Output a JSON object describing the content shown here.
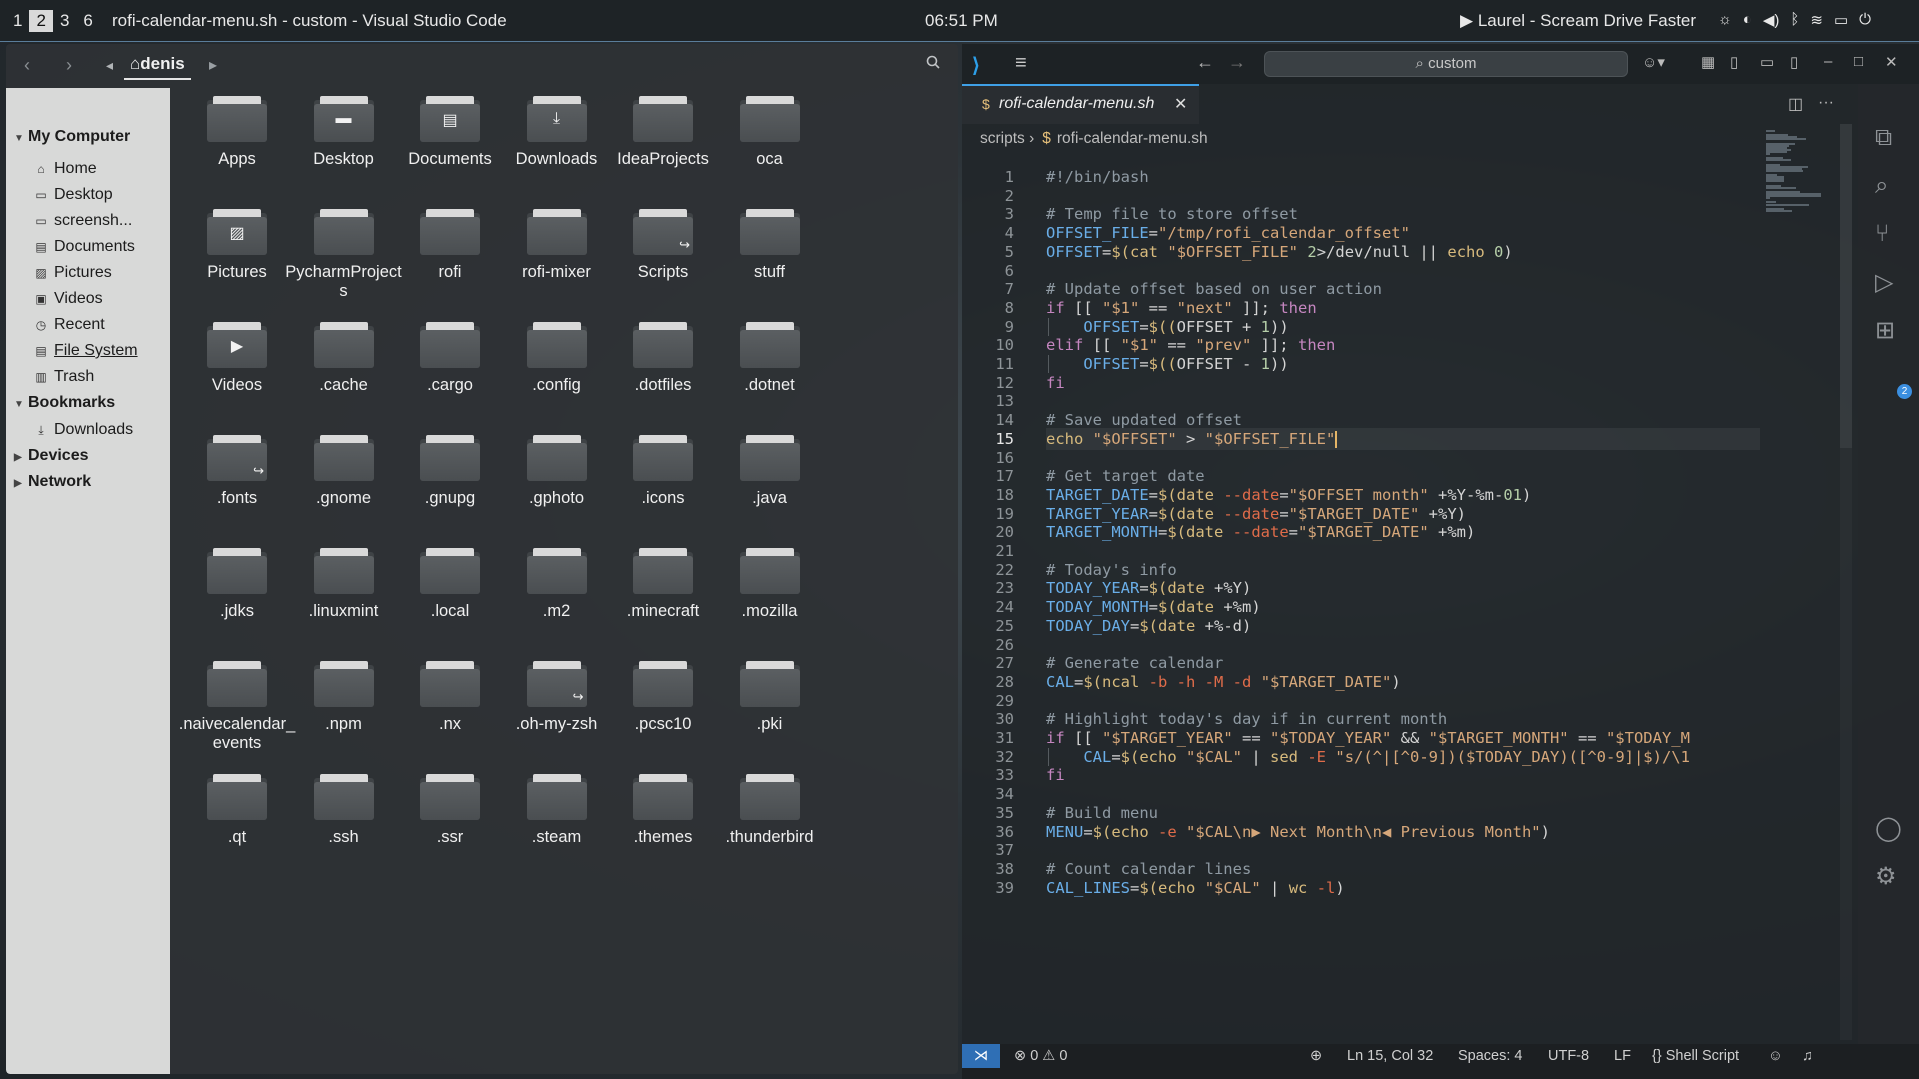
{
  "topbar": {
    "workspaces": [
      "1",
      "2",
      "3",
      "6"
    ],
    "active_workspace": "2",
    "window_title": "rofi-calendar-menu.sh - custom - Visual Studio Code",
    "clock": "06:51 PM",
    "now_playing": "Laurel - Scream Drive Faster",
    "play_icon": "▶"
  },
  "file_manager": {
    "current_folder": "denis",
    "sidebar": {
      "my_computer": "My Computer",
      "places": [
        {
          "label": "Home",
          "icon": "home-icon",
          "glyph": "⌂"
        },
        {
          "label": "Desktop",
          "icon": "desktop-icon",
          "glyph": "▭"
        },
        {
          "label": "screensh...",
          "icon": "folder-icon",
          "glyph": "▭"
        },
        {
          "label": "Documents",
          "icon": "document-icon",
          "glyph": "▤"
        },
        {
          "label": "Pictures",
          "icon": "picture-icon",
          "glyph": "▨"
        },
        {
          "label": "Videos",
          "icon": "video-icon",
          "glyph": "▣"
        },
        {
          "label": "Recent",
          "icon": "clock-icon",
          "glyph": "◷"
        },
        {
          "label": "File System",
          "icon": "drive-icon",
          "glyph": "▤"
        },
        {
          "label": "Trash",
          "icon": "trash-icon",
          "glyph": "▥"
        }
      ],
      "bookmarks": "Bookmarks",
      "bookmark_items": [
        {
          "label": "Downloads",
          "icon": "download-icon",
          "glyph": "⤓"
        }
      ],
      "devices": "Devices",
      "network": "Network"
    },
    "items": [
      {
        "name": "Apps"
      },
      {
        "name": "Desktop",
        "emblem": "desktop"
      },
      {
        "name": "Documents",
        "emblem": "document"
      },
      {
        "name": "Downloads",
        "emblem": "download"
      },
      {
        "name": "IdeaProjects"
      },
      {
        "name": "oca"
      },
      {
        "name": "Pictures",
        "emblem": "picture"
      },
      {
        "name": "PycharmProjects"
      },
      {
        "name": "rofi"
      },
      {
        "name": "rofi-mixer"
      },
      {
        "name": "Scripts",
        "emblem": "link"
      },
      {
        "name": "stuff"
      },
      {
        "name": "Videos",
        "emblem": "video"
      },
      {
        "name": ".cache"
      },
      {
        "name": ".cargo"
      },
      {
        "name": ".config"
      },
      {
        "name": ".dotfiles"
      },
      {
        "name": ".dotnet"
      },
      {
        "name": ".fonts",
        "emblem": "link"
      },
      {
        "name": ".gnome"
      },
      {
        "name": ".gnupg"
      },
      {
        "name": ".gphoto"
      },
      {
        "name": ".icons"
      },
      {
        "name": ".java"
      },
      {
        "name": ".jdks"
      },
      {
        "name": ".linuxmint"
      },
      {
        "name": ".local"
      },
      {
        "name": ".m2"
      },
      {
        "name": ".minecraft"
      },
      {
        "name": ".mozilla"
      },
      {
        "name": ".naivecalendar_events"
      },
      {
        "name": ".npm"
      },
      {
        "name": ".nx"
      },
      {
        "name": ".oh-my-zsh",
        "emblem": "link"
      },
      {
        "name": ".pcsc10"
      },
      {
        "name": ".pki"
      },
      {
        "name": ".qt"
      },
      {
        "name": ".ssh"
      },
      {
        "name": ".ssr"
      },
      {
        "name": ".steam"
      },
      {
        "name": ".themes"
      },
      {
        "name": ".thunderbird"
      }
    ]
  },
  "vscode": {
    "command_center": "custom",
    "tab_name": "rofi-calendar-menu.sh",
    "breadcrumb": [
      "scripts",
      "rofi-calendar-menu.sh"
    ],
    "current_line": 15,
    "lines": [
      "#!/bin/bash",
      "",
      "# Temp file to store offset",
      "OFFSET_FILE=\"/tmp/rofi_calendar_offset\"",
      "OFFSET=$(cat \"$OFFSET_FILE\" 2>/dev/null || echo 0)",
      "",
      "# Update offset based on user action",
      "if [[ \"$1\" == \"next\" ]]; then",
      "    OFFSET=$((OFFSET + 1))",
      "elif [[ \"$1\" == \"prev\" ]]; then",
      "    OFFSET=$((OFFSET - 1))",
      "fi",
      "",
      "# Save updated offset",
      "echo \"$OFFSET\" > \"$OFFSET_FILE\"",
      "",
      "# Get target date",
      "TARGET_DATE=$(date --date=\"$OFFSET month\" +%Y-%m-01)",
      "TARGET_YEAR=$(date --date=\"$TARGET_DATE\" +%Y)",
      "TARGET_MONTH=$(date --date=\"$TARGET_DATE\" +%m)",
      "",
      "# Today's info",
      "TODAY_YEAR=$(date +%Y)",
      "TODAY_MONTH=$(date +%m)",
      "TODAY_DAY=$(date +%-d)",
      "",
      "# Generate calendar",
      "CAL=$(ncal -b -h -M -d \"$TARGET_DATE\")",
      "",
      "# Highlight today's day if in current month",
      "if [[ \"$TARGET_YEAR\" == \"$TODAY_YEAR\" && \"$TARGET_MONTH\" == \"$TODAY_M",
      "    CAL=$(echo \"$CAL\" | sed -E \"s/(^|[^0-9])($TODAY_DAY)([^0-9]|$)/\\1",
      "fi",
      "",
      "# Build menu",
      "MENU=$(echo -e \"$CAL\\n▶ Next Month\\n◀ Previous Month\")",
      "",
      "# Count calendar lines",
      "CAL_LINES=$(echo \"$CAL\" | wc -l)"
    ],
    "status": {
      "errors": "0",
      "warnings": "0",
      "position": "Ln 15, Col 32",
      "spaces": "Spaces: 4",
      "encoding": "UTF-8",
      "eol": "LF",
      "language": "Shell Script",
      "extensions_badge": "2"
    }
  },
  "colors": {
    "vscode_accent": "#3fa0e6",
    "comment": "#8f9aa3",
    "variable": "#6aaee8",
    "string": "#d6a77a",
    "keyword": "#c586c0",
    "sidebar_bg": "#d8d9d8"
  }
}
